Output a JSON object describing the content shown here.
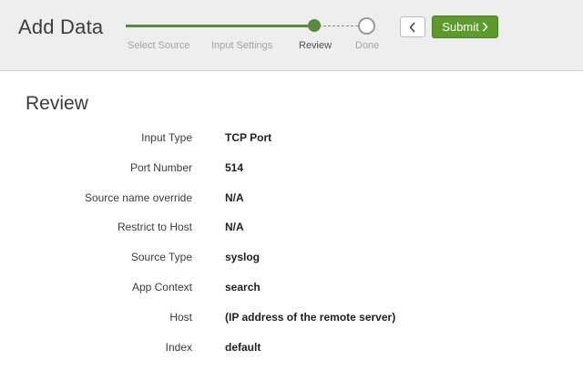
{
  "header": {
    "title": "Add Data",
    "steps": [
      {
        "label": "Select Source"
      },
      {
        "label": "Input Settings"
      },
      {
        "label": "Review"
      },
      {
        "label": "Done"
      }
    ],
    "back_icon": "chevron-left-icon",
    "submit_label": "Submit",
    "submit_icon": "chevron-right-icon"
  },
  "review": {
    "title": "Review",
    "rows": [
      {
        "label": "Input Type",
        "value": "TCP Port"
      },
      {
        "label": "Port Number",
        "value": "514"
      },
      {
        "label": "Source name override",
        "value": "N/A"
      },
      {
        "label": "Restrict to Host",
        "value": "N/A"
      },
      {
        "label": "Source Type",
        "value": "syslog"
      },
      {
        "label": "App Context",
        "value": "search"
      },
      {
        "label": "Host",
        "value": "(IP address of the remote server)"
      },
      {
        "label": "Index",
        "value": "default"
      }
    ]
  },
  "colors": {
    "accent": "#5c9b2b",
    "header_bg": "#eeeeee"
  }
}
